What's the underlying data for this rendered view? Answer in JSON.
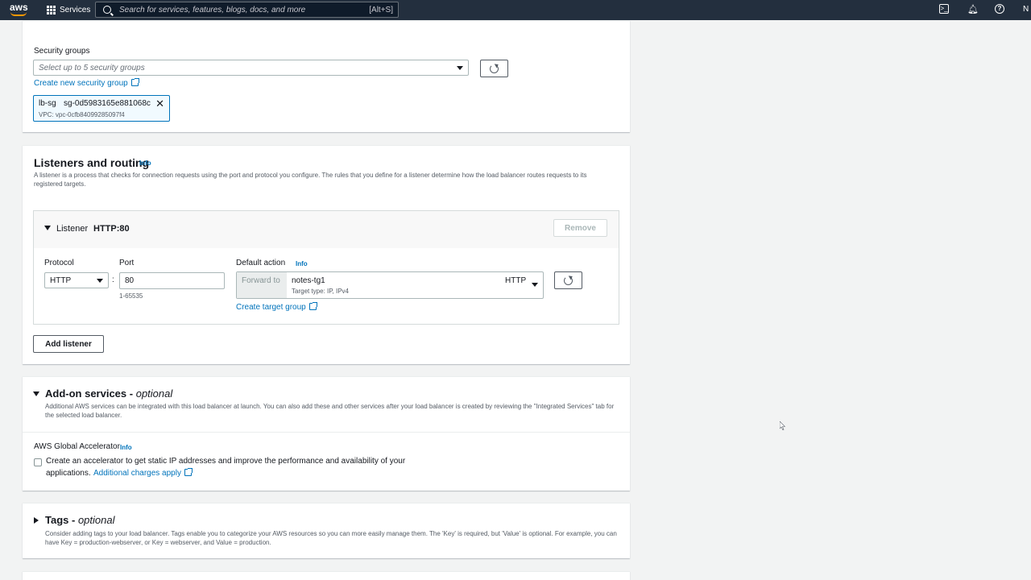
{
  "topnav": {
    "logo": "aws",
    "services_label": "Services",
    "search_placeholder": "Search for services, features, blogs, docs, and more",
    "search_hint": "[Alt+S]",
    "user_initial": "N",
    "icons": [
      "grid-icon",
      "search-icon",
      "cloudshell-icon",
      "bell-icon",
      "help-icon"
    ]
  },
  "security": {
    "label": "Security groups",
    "select_placeholder": "Select up to 5 security groups",
    "create_link": "Create new security group",
    "token": {
      "name": "lb-sg",
      "id": "sg-0d5983165e881068c",
      "vpc": "VPC: vpc-0cfb84099285097f4"
    }
  },
  "listeners": {
    "title": "Listeners and routing",
    "info": "Info",
    "description": "A listener is a process that checks for connection requests using the port and protocol you configure. The rules that you define for a listener determine how the load balancer routes requests to its registered targets.",
    "listener": {
      "label": "Listener",
      "name": "HTTP:80",
      "remove_label": "Remove",
      "protocol_label": "Protocol",
      "protocol_value": "HTTP",
      "separator": ":",
      "port_label": "Port",
      "port_value": "80",
      "port_hint": "1-65535",
      "default_action_label": "Default action",
      "default_action_info": "Info",
      "forward_to_label": "Forward to",
      "target_group": "notes-tg1",
      "target_type": "Target type: IP, IPv4",
      "target_protocol": "HTTP",
      "create_target_link": "Create target group"
    },
    "add_listener_label": "Add listener"
  },
  "addons": {
    "title": "Add-on services -",
    "title_optional": "optional",
    "description": "Additional AWS services can be integrated with this load balancer at launch. You can also add these and other services after your load balancer is created by reviewing the \"Integrated Services\" tab for the selected load balancer.",
    "accelerator_label": "AWS Global Accelerator",
    "accelerator_info": "Info",
    "checkbox_text": "Create an accelerator to get static IP addresses and improve the performance and availability of your",
    "checkbox_text2": "applications.",
    "charges_link": "Additional charges apply",
    "checked": false
  },
  "tags": {
    "title": "Tags -",
    "title_optional": "optional",
    "description": "Consider adding tags to your load balancer. Tags enable you to categorize your AWS resources so you can more easily manage them. The 'Key' is required, but 'Value' is optional. For example, you can have Key = production-webserver, or Key = webserver, and Value = production."
  },
  "colors": {
    "nav_bg": "#232f3e",
    "link": "#0073bb",
    "accent": "#ff9900",
    "page_bg": "#f2f3f3"
  }
}
